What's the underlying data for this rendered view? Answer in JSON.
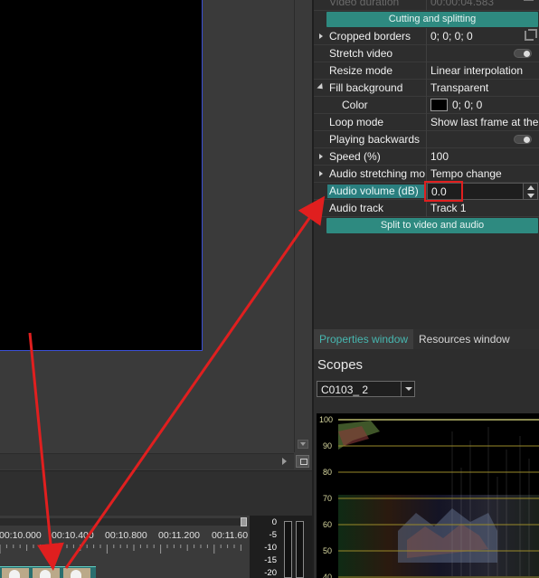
{
  "properties": {
    "video_duration_label": "Video duration",
    "video_duration_value": "00:00:04.583",
    "cutting_button": "Cutting and splitting",
    "rows": [
      {
        "name": "Cropped borders",
        "value": "0; 0; 0; 0"
      },
      {
        "name": "Stretch video",
        "value": ""
      },
      {
        "name": "Resize mode",
        "value": "Linear interpolation"
      },
      {
        "name": "Fill background",
        "value": "Transparent"
      },
      {
        "name": "Color",
        "value": "0; 0; 0"
      },
      {
        "name": "Loop mode",
        "value": "Show last frame at the"
      },
      {
        "name": "Playing backwards",
        "value": ""
      },
      {
        "name": "Speed (%)",
        "value": "100"
      },
      {
        "name": "Audio stretching mo",
        "value": "Tempo change"
      },
      {
        "name": "Audio volume (dB)",
        "value": "0.0"
      },
      {
        "name": "Audio track",
        "value": "Track 1"
      }
    ],
    "split_button": "Split to video and audio",
    "color_swatch": "#000000"
  },
  "tabs": {
    "properties": "Properties window",
    "resources": "Resources window"
  },
  "scopes": {
    "title": "Scopes",
    "selected_clip": "C0103_ 2",
    "scale": [
      "100",
      "90",
      "80",
      "70",
      "60",
      "50",
      "40"
    ]
  },
  "timeline": {
    "ruler_labels": [
      "00:10.000",
      "00:10.400",
      "00:10.800",
      "00:11.200",
      "00:11.60"
    ]
  },
  "meter": {
    "labels": [
      "0",
      "-5",
      "-10",
      "-15",
      "-20"
    ]
  },
  "colors": {
    "accent_teal": "#2e8a80",
    "highlight_teal": "#2a7f7f",
    "annotation_red": "#e01f1f",
    "tab_active_text": "#47b7b0"
  }
}
